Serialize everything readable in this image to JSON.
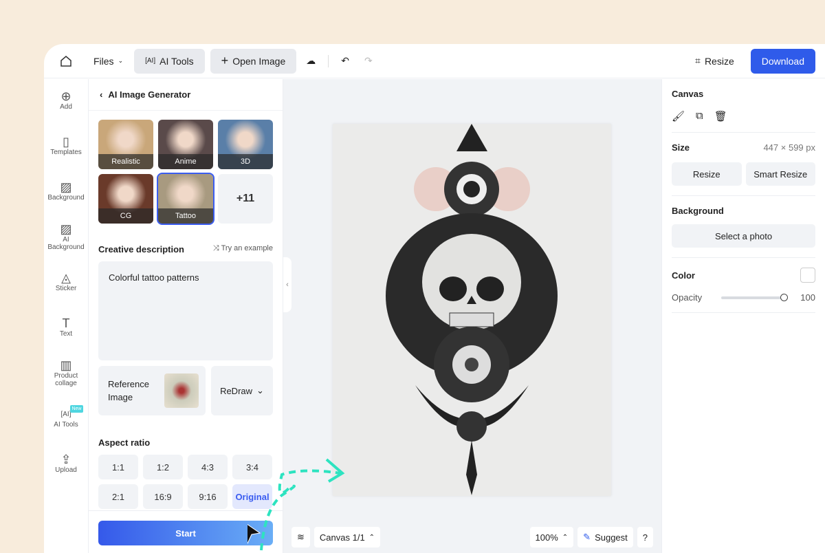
{
  "topbar": {
    "files": "Files",
    "ai_tools": "AI Tools",
    "open_image": "Open Image",
    "resize": "Resize",
    "download": "Download"
  },
  "rail": [
    {
      "label": "Add",
      "icon": "plus-circle-icon"
    },
    {
      "label": "Templates",
      "icon": "templates-icon"
    },
    {
      "label": "Background",
      "icon": "background-icon"
    },
    {
      "label": "AI Background",
      "icon": "ai-background-icon"
    },
    {
      "label": "Sticker",
      "icon": "sticker-icon"
    },
    {
      "label": "Text",
      "icon": "text-icon"
    },
    {
      "label": "Product collage",
      "icon": "collage-icon"
    },
    {
      "label": "AI Tools",
      "icon": "ai-tools-icon",
      "badge": "New"
    },
    {
      "label": "Upload",
      "icon": "upload-icon"
    }
  ],
  "panel": {
    "title": "AI Image Generator",
    "styles": [
      {
        "label": "Realistic",
        "color": "#c9a77a"
      },
      {
        "label": "Anime",
        "color": "#5a4a4a"
      },
      {
        "label": "3D",
        "color": "#5a7fa8"
      },
      {
        "label": "CG",
        "color": "#6a3a2a"
      },
      {
        "label": "Tattoo",
        "color": "#a89a80",
        "selected": true
      }
    ],
    "more": "+11",
    "desc_title": "Creative description",
    "try_example": "Try an example",
    "desc_value": "Colorful tattoo patterns",
    "reference": "Reference Image",
    "redraw": "ReDraw",
    "aspect_title": "Aspect ratio",
    "ratios": [
      "1:1",
      "1:2",
      "4:3",
      "3:4",
      "2:1",
      "16:9",
      "9:16",
      "Original"
    ],
    "selected_ratio": "Original",
    "start": "Start"
  },
  "canvas": {
    "page": "Canvas 1/1",
    "zoom": "100%",
    "suggest": "Suggest",
    "help": "?"
  },
  "right": {
    "title": "Canvas",
    "size_label": "Size",
    "size_value": "447 × 599 px",
    "resize": "Resize",
    "smart_resize": "Smart Resize",
    "background": "Background",
    "select_photo": "Select a photo",
    "color": "Color",
    "opacity": "Opacity",
    "opacity_value": "100"
  },
  "colors": {
    "accent": "#2f5bea",
    "page_bg": "#f8ecdc",
    "arrow": "#2de3c0"
  }
}
